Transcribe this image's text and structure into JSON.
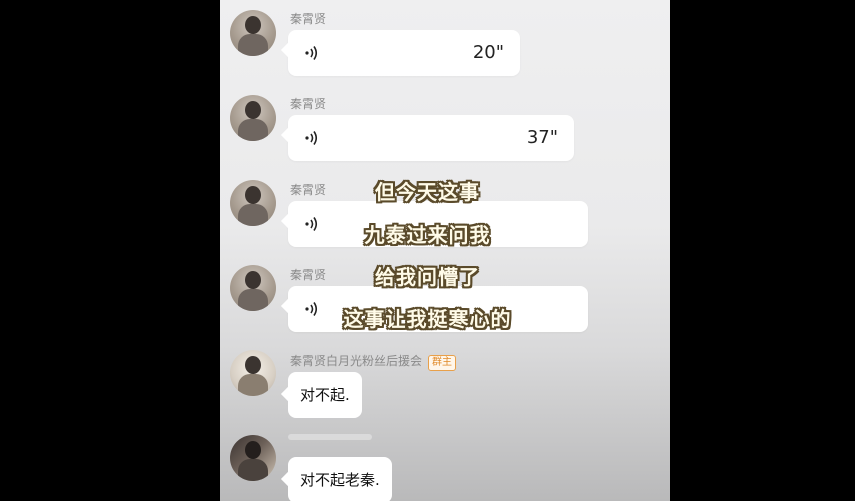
{
  "chat": {
    "messages": [
      {
        "sender": "秦霄贤",
        "type": "voice",
        "duration": "20\""
      },
      {
        "sender": "秦霄贤",
        "type": "voice",
        "duration": "37\""
      },
      {
        "sender": "秦霄贤",
        "type": "voice",
        "duration": ""
      },
      {
        "sender": "秦霄贤",
        "type": "voice",
        "duration": ""
      },
      {
        "sender": "秦霄贤白月光粉丝后援会",
        "badge": "群主",
        "type": "text",
        "text": "对不起."
      },
      {
        "sender": "",
        "type": "text",
        "text": "对不起老秦."
      }
    ]
  },
  "subtitles": [
    "但今天这事",
    "九泰过来问我",
    "给我问懵了",
    "这事让我挺寒心的"
  ],
  "icons": {
    "voice": "voice-wave-icon"
  }
}
